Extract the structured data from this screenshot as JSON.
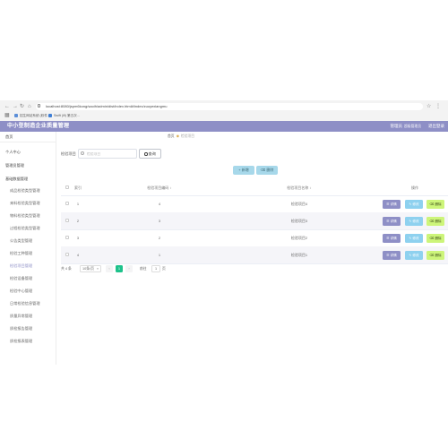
{
  "browser": {
    "url": "localhost:8080/jspm6kong/saoih/admin/dist/index.html#/index/zuoyexiangmu",
    "bookmarks": [
      "招生网站系统 (软件...",
      "Swift (i9) 第五次..."
    ]
  },
  "header": {
    "title": "中小型制造企业质量管理",
    "user": "管理员",
    "role": "超级管理员",
    "logout": "退出登录"
  },
  "sidebar": {
    "items": [
      {
        "label": "首页",
        "level": 0
      },
      {
        "label": "个人中心",
        "level": 0
      },
      {
        "label": "管理员管理",
        "level": 0
      },
      {
        "label": "基础数据管理",
        "level": 0
      },
      {
        "label": "成品检验类型管理",
        "level": 1
      },
      {
        "label": "来料检验类型管理",
        "level": 1
      },
      {
        "label": "物料检验类型管理",
        "level": 1
      },
      {
        "label": "过程检验类型管理",
        "level": 1
      },
      {
        "label": "公告类型管理",
        "level": 1
      },
      {
        "label": "检验工种管理",
        "level": 1
      },
      {
        "label": "检验项目管理",
        "level": 1
      },
      {
        "label": "检验设备管理",
        "level": 1
      },
      {
        "label": "检验中心管理",
        "level": 1
      },
      {
        "label": "日常检验信息管理",
        "level": 1
      },
      {
        "label": "质量异常管理",
        "level": 1
      },
      {
        "label": "质检报告管理",
        "level": 1
      },
      {
        "label": "质检报表管理",
        "level": 1
      }
    ]
  },
  "breadcrumb": {
    "home": "首页",
    "current": "检验项目"
  },
  "search": {
    "label": "检验项目",
    "placeholder": "检验项目",
    "button": "查询"
  },
  "toolbar": {
    "add": "+ 新增",
    "delete": "删除"
  },
  "table": {
    "columns": {
      "index": "索引",
      "code": "检验项目编码",
      "name": "检验项目名称",
      "actions": "操作"
    },
    "rows": [
      {
        "index": "1",
        "code": "4",
        "name": "检验项目4"
      },
      {
        "index": "2",
        "code": "3",
        "name": "检验项目3"
      },
      {
        "index": "3",
        "code": "2",
        "name": "检验项目2"
      },
      {
        "index": "4",
        "code": "1",
        "name": "检验项目1"
      }
    ],
    "actions": {
      "detail": "详情",
      "edit": "修改",
      "delete": "删除"
    }
  },
  "pagination": {
    "total": "共 4 条",
    "page_size": "10条/页",
    "current_page": "1",
    "goto_label": "前往",
    "goto_value": "1",
    "goto_unit": "页"
  },
  "colors": {
    "header": "#8e8fc6",
    "detail": "#8e8fc6",
    "edit": "#8ed1ef",
    "delete": "#cdf57a",
    "add": "#a7d8ea",
    "pager_active": "#1ec28b"
  }
}
